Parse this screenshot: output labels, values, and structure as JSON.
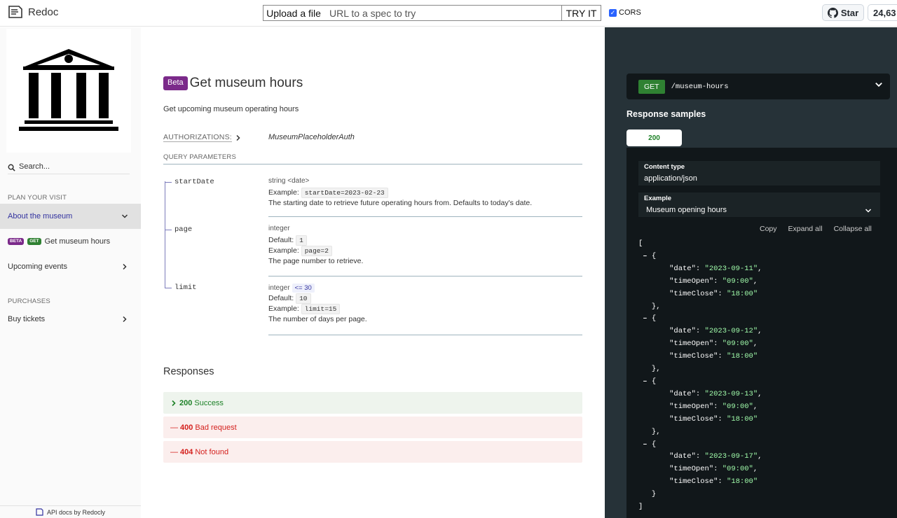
{
  "topbar": {
    "logo_text": "Redoc",
    "upload_label": "Upload a file",
    "url_placeholder": "URL to a spec to try",
    "tryit_label": "TRY IT",
    "cors_label": "CORS",
    "star_label": "Star",
    "star_count": "24,63"
  },
  "sidebar": {
    "search_placeholder": "Search...",
    "sections": [
      {
        "heading": "PLAN YOUR VISIT"
      },
      {
        "heading": "PURCHASES"
      }
    ],
    "items": [
      {
        "label": "About the museum"
      },
      {
        "label": "Get museum hours",
        "tag_beta": "BETA",
        "tag_method": "GET"
      },
      {
        "label": "Upcoming events"
      },
      {
        "label": "Buy tickets"
      }
    ],
    "footer": "API docs by Redocly"
  },
  "operation": {
    "badge": "Beta",
    "title": "Get museum hours",
    "description": "Get upcoming museum operating hours",
    "auth_label": "AUTHORIZATIONS:",
    "auth_value": "MuseumPlaceholderAuth",
    "query_heading": "QUERY PARAMETERS",
    "params": [
      {
        "name": "startDate",
        "type": "string <date>",
        "example_label": "Example:",
        "example": "startDate=2023-02-23",
        "description": "The starting date to retrieve future operating hours from. Defaults to today's date."
      },
      {
        "name": "page",
        "type": "integer",
        "default_label": "Default:",
        "default": "1",
        "example_label": "Example:",
        "example": "page=2",
        "description": "The page number to retrieve."
      },
      {
        "name": "limit",
        "type": "integer",
        "constraint": "<= 30",
        "default_label": "Default:",
        "default": "10",
        "example_label": "Example:",
        "example": "limit=15",
        "description": "The number of days per page."
      }
    ],
    "responses_heading": "Responses",
    "responses": [
      {
        "code": "200",
        "label": "Success"
      },
      {
        "code": "400",
        "label": "Bad request"
      },
      {
        "code": "404",
        "label": "Not found"
      }
    ]
  },
  "panel": {
    "method": "GET",
    "path": "/museum-hours",
    "samples_heading": "Response samples",
    "tab": "200",
    "content_type_label": "Content type",
    "content_type": "application/json",
    "example_label": "Example",
    "example_value": "Museum opening hours",
    "copy": "Copy",
    "expand": "Expand all",
    "collapse": "Collapse all",
    "json_entries": [
      {
        "date": "2023-09-11",
        "timeOpen": "09:00",
        "timeClose": "18:00"
      },
      {
        "date": "2023-09-12",
        "timeOpen": "09:00",
        "timeClose": "18:00"
      },
      {
        "date": "2023-09-13",
        "timeOpen": "09:00",
        "timeClose": "18:00"
      },
      {
        "date": "2023-09-17",
        "timeOpen": "09:00",
        "timeClose": "18:00"
      }
    ]
  }
}
